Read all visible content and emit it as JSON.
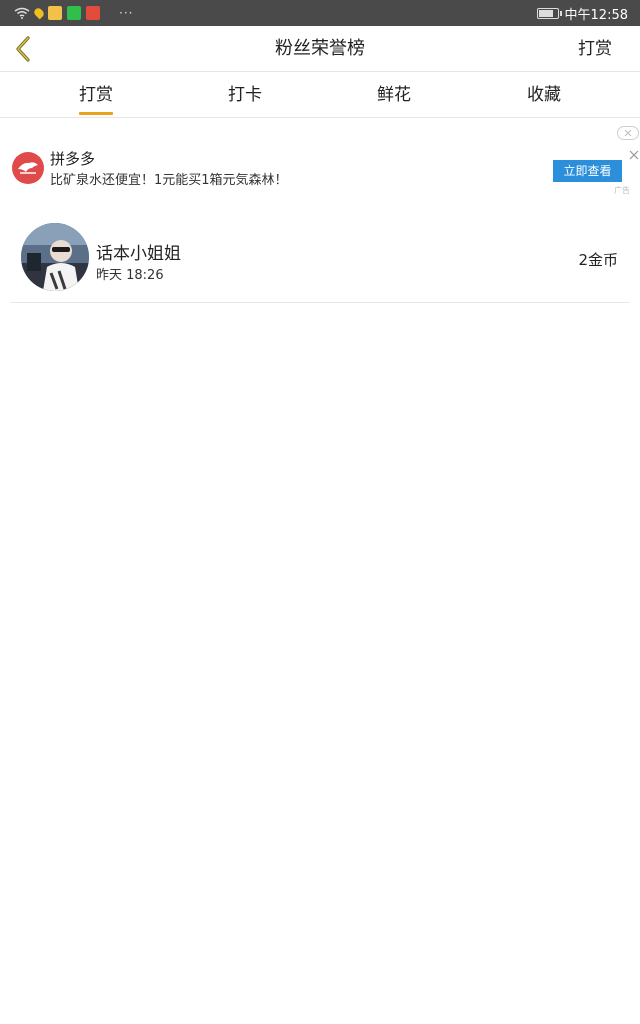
{
  "status_bar": {
    "dots": "···",
    "time": "中午12:58",
    "battery_level": 0.8,
    "icons": [
      "wifi-icon",
      "location-icon",
      "app-notification-icon",
      "message-notification-icon",
      "game-notification-icon"
    ]
  },
  "header": {
    "title": "粉丝荣誉榜",
    "action_label": "打赏",
    "back_icon": "chevron-left-icon"
  },
  "tabs": [
    {
      "label": "打赏",
      "active": true
    },
    {
      "label": "打卡",
      "active": false
    },
    {
      "label": "鲜花",
      "active": false
    },
    {
      "label": "收藏",
      "active": false
    }
  ],
  "ad": {
    "brand": "拼多多",
    "description": "比矿泉水还便宜！1元能买1箱元気森林！",
    "cta_label": "立即查看",
    "mark": "广告"
  },
  "list": [
    {
      "name": "话本小姐姐",
      "time": "昨天 18:26",
      "amount": "2金币"
    }
  ],
  "colors": {
    "accent": "#e8a21b",
    "ad_button": "#2b8fdc",
    "ad_logo": "#e04a4a",
    "status_bar_bg": "#4a4a4a"
  }
}
